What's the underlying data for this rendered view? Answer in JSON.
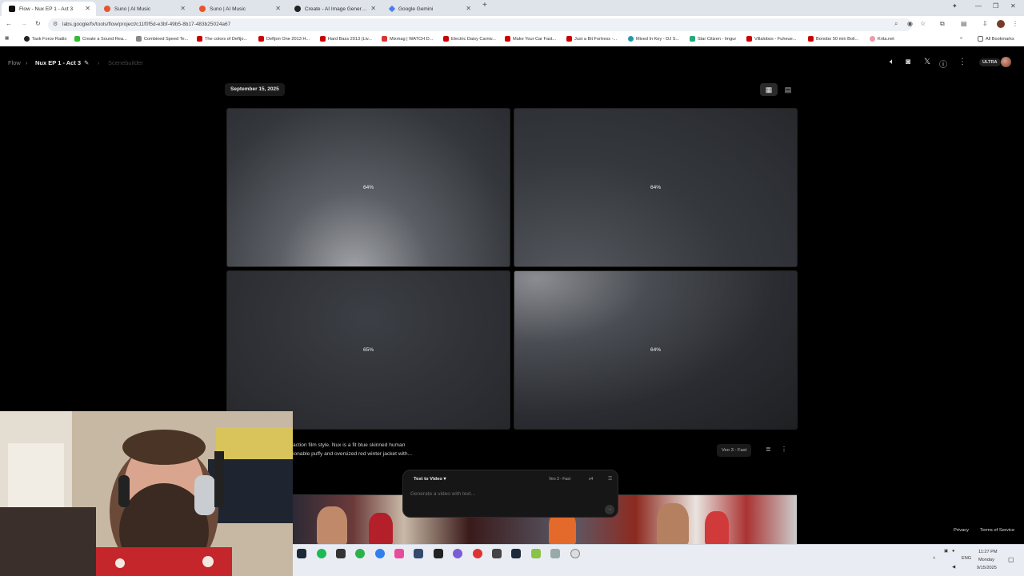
{
  "browser": {
    "tabs": [
      {
        "label": "Flow - Nux EP 1 - Act 3",
        "active": true,
        "favicon_color": "#111111"
      },
      {
        "label": "Suno | AI Music",
        "active": false,
        "favicon_color": "#e8542b"
      },
      {
        "label": "Suno | AI Music",
        "active": false,
        "favicon_color": "#e8542b"
      },
      {
        "label": "Create - AI Image Generator | L",
        "active": false,
        "favicon_color": "#222222"
      },
      {
        "label": "Google Gemini",
        "active": false,
        "favicon_color": "#4b7cf3"
      }
    ],
    "new_tab": "+",
    "url": "labs.google/fx/tools/flow/project/c11f0f5d-e3bf-49b5-8b17-483b25024a67",
    "bookmarks": [
      {
        "label": "Task Force Radio",
        "color": "#222"
      },
      {
        "label": "Create a Sound Rea...",
        "color": "#3b3"
      },
      {
        "label": "Combined Speed Te...",
        "color": "#888"
      },
      {
        "label": "The colors of Deftjo...",
        "color": "#c00"
      },
      {
        "label": "Deftjon One 2013 H...",
        "color": "#c00"
      },
      {
        "label": "Hard Bass 2013 (Liv...",
        "color": "#c00"
      },
      {
        "label": "Mixmag | WATCH D...",
        "color": "#d33"
      },
      {
        "label": "Electric Daisy Carniv...",
        "color": "#c00"
      },
      {
        "label": "Make Your Car Fast...",
        "color": "#c00"
      },
      {
        "label": "Just a Bit Fortress -...",
        "color": "#c00"
      },
      {
        "label": "Mixed In Key - DJ S...",
        "color": "#29a"
      },
      {
        "label": "Star Citizen - Imgur",
        "color": "#2a7"
      },
      {
        "label": "Villalobos - Fuheue...",
        "color": "#c00"
      },
      {
        "label": "Bonobo 50 min Boil...",
        "color": "#c00"
      },
      {
        "label": "Krita.net",
        "color": "#e9a"
      }
    ],
    "all_bookmarks": "All Bookmarks"
  },
  "app": {
    "breadcrumb": {
      "root": "Flow",
      "project": "Nux EP 1 - Act 3",
      "view": "Scenebuilder"
    },
    "plan_badge": "ULTRA",
    "date": "September 15, 2025",
    "generations": [
      {
        "progress": "64%"
      },
      {
        "progress": "64%"
      },
      {
        "progress": "65%"
      },
      {
        "progress": "64%"
      }
    ],
    "prompt_preview_line1": "action film style. Nux is a fit blue skinned human",
    "prompt_preview_line2": "ionable puffy and oversized red winter jacket with...",
    "model_chip": "Veo 3 - Fast",
    "composer": {
      "mode": "Text to Video",
      "model": "Veo 3 - Fast",
      "count": "x4",
      "placeholder": "Generate a video with text..."
    },
    "footer": {
      "privacy": "Privacy",
      "terms": "Terms of Service"
    }
  },
  "taskbar": {
    "language": "ENG",
    "time": "11:27 PM",
    "day": "Monday",
    "date": "9/15/2025"
  }
}
